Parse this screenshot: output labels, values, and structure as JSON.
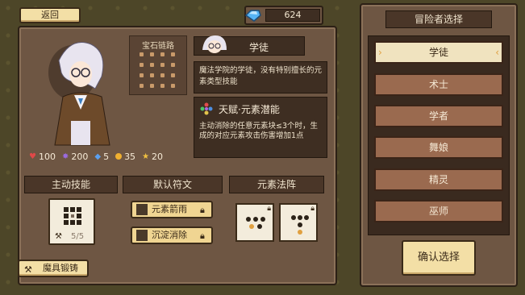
{
  "header": {
    "back_label": "返回",
    "currency_value": "624"
  },
  "character": {
    "gem_path_label": "宝石链路",
    "class_name": "学徒",
    "description": "魔法学院的学徒，没有特别擅长的元素类型技能",
    "talent_title": "天赋·元素潜能",
    "talent_desc": "主动消除的任意元素块≤3个时，生成的对应元素攻击伤害增加1点",
    "stats": {
      "hp": "100",
      "mana": "200",
      "shield": "5",
      "gold": "35",
      "star": "20"
    }
  },
  "tabs": {
    "active_skill": "主动技能",
    "default_rune": "默认符文",
    "element_array": "元素法阵"
  },
  "skill": {
    "uses": "5/5"
  },
  "runes": [
    {
      "label": "元素箭雨"
    },
    {
      "label": "沉淀消除"
    }
  ],
  "forge_label": "魔具锻铸",
  "selection": {
    "title": "冒险者选择",
    "classes": [
      "学徒",
      "术士",
      "学者",
      "舞娘",
      "精灵",
      "巫师"
    ],
    "selected_index": 0,
    "confirm_label": "确认选择"
  }
}
